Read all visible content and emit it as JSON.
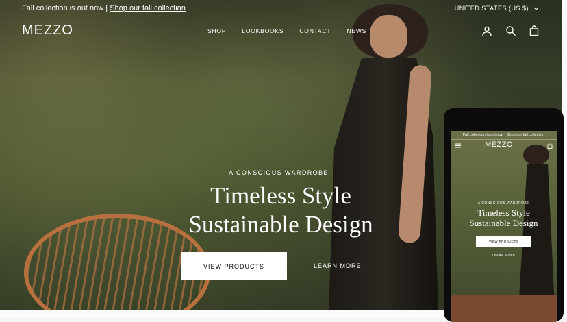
{
  "announcement": {
    "text": "Fall collection is out now | ",
    "link": "Shop our fall collection"
  },
  "region": "UNITED STATES (US $)",
  "header": {
    "logo": "MEZZO",
    "nav": [
      "SHOP",
      "LOOKBOOKS",
      "CONTACT",
      "NEWS"
    ],
    "icons": [
      "account-icon",
      "search-icon",
      "cart-icon"
    ]
  },
  "hero": {
    "eyebrow": "A CONSCIOUS WARDROBE",
    "title_line1": "Timeless Style",
    "title_line2": "Sustainable Design",
    "primary_button": "VIEW PRODUCTS",
    "secondary_link": "LEARN MORE"
  },
  "mobile": {
    "announcement": "Fall collection is out now | Shop our fall collection",
    "logo": "MEZZO",
    "eyebrow": "A CONSCIOUS WARDROBE",
    "title_line1": "Timeless Style",
    "title_line2": "Sustainable Design",
    "primary_button": "VIEW PRODUCTS",
    "secondary_link": "LEARN MORE"
  },
  "colors": {
    "text": "#ffffff",
    "button_bg": "#ffffff",
    "button_text": "#111111"
  }
}
